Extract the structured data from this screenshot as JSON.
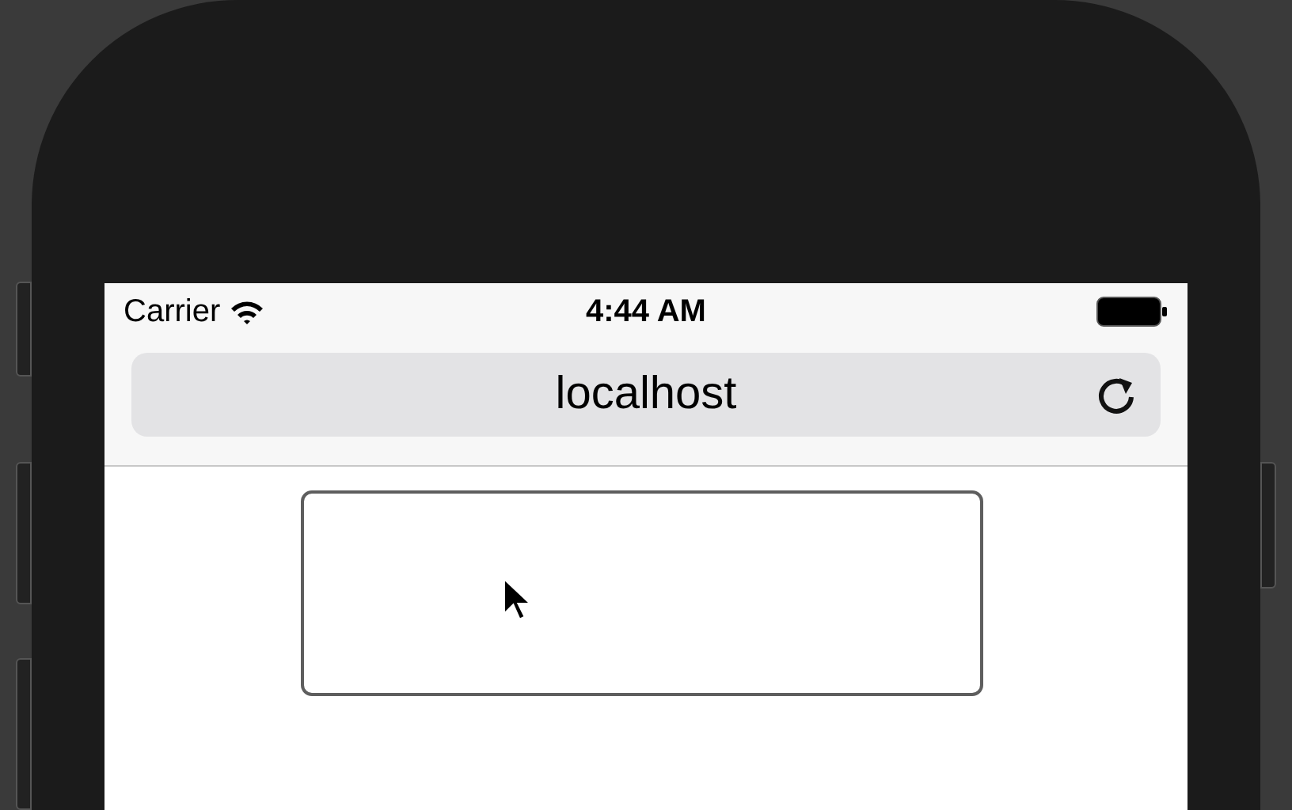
{
  "status_bar": {
    "carrier": "Carrier",
    "time": "4:44 AM"
  },
  "address_bar": {
    "url": "localhost"
  }
}
